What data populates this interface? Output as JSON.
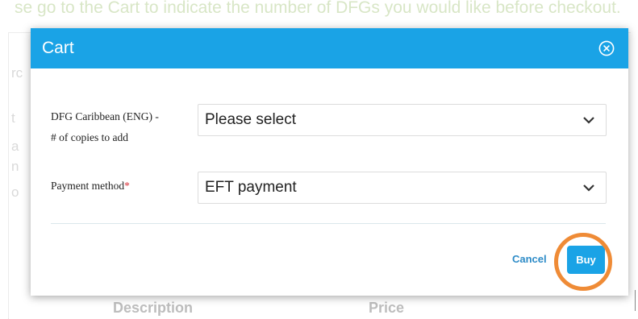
{
  "background": {
    "banner_text": "se go to the Cart to indicate the number of DFGs you would like before checkout.",
    "fragments": [
      "rc",
      "t",
      "a",
      "n",
      "o"
    ],
    "columns": {
      "description": "Description",
      "price": "Price"
    }
  },
  "modal": {
    "title": "Cart",
    "fields": [
      {
        "label_line1": "DFG Caribbean (ENG) -",
        "label_line2": "# of copies to add",
        "value": "Please select",
        "required": false
      },
      {
        "label_line1": "Payment method",
        "required_mark": "*",
        "value": "EFT payment",
        "required": true
      }
    ],
    "footer": {
      "cancel_label": "Cancel",
      "buy_label": "Buy"
    }
  },
  "colors": {
    "header": "#1aa3e6",
    "accent_link": "#2d8bc7",
    "required": "#d9333b",
    "highlight": "#ef8b36"
  }
}
